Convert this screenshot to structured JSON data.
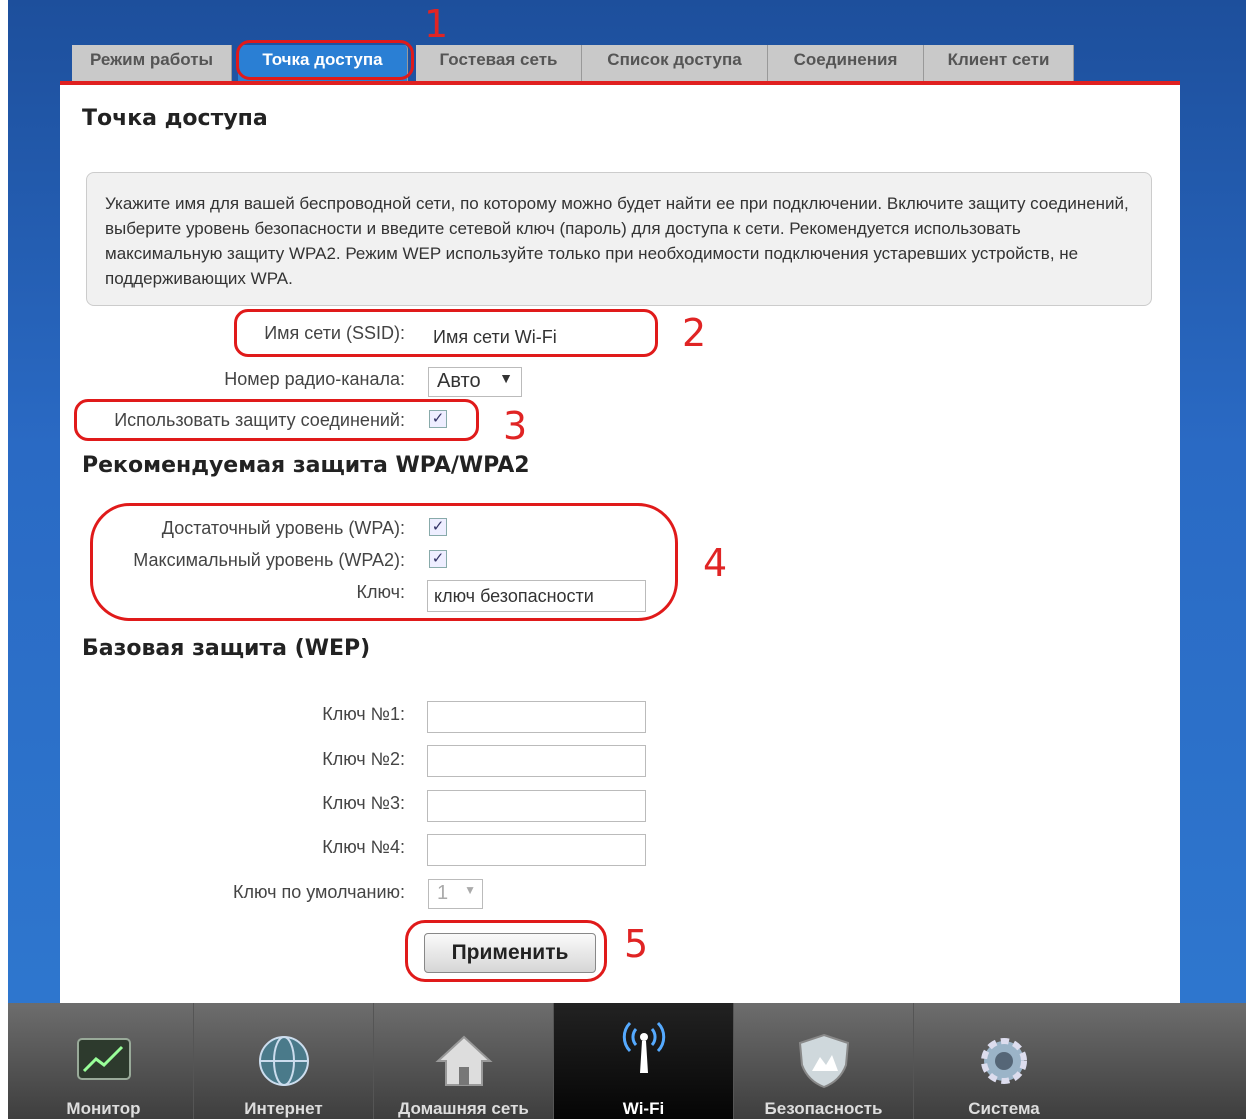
{
  "tabs": [
    "Режим работы",
    "Точка доступа",
    "Гостевая сеть",
    "Список доступа",
    "Соединения",
    "Клиент сети"
  ],
  "title": "Точка доступа",
  "note": "Укажите имя для вашей беспроводной сети, по которому можно будет найти ее при подключении. Включите защиту соединений, выберите уровень безопасности и введите сетевой ключ (пароль) для доступа к сети. Рекомендуется использовать максимальную защиту WPA2. Режим WEP используйте только при необходимости подключения устаревших устройств, не поддерживающих WPA.",
  "ssid": {
    "label": "Имя сети (SSID):",
    "value": "Имя сети Wi-Fi"
  },
  "channel": {
    "label": "Номер радио-канала:",
    "value": "Авто"
  },
  "protect": {
    "label": "Использовать защиту соединений:",
    "checked": true
  },
  "wpa_title": "Рекомендуемая защита WPA/WPA2",
  "wpa": {
    "label": "Достаточный уровень (WPA):",
    "checked": true
  },
  "wpa2": {
    "label": "Максимальный уровень (WPA2):",
    "checked": true
  },
  "key": {
    "label": "Ключ:",
    "value": "ключ безопасности"
  },
  "wep_title": "Базовая защита (WEP)",
  "wep_keys": [
    {
      "label": "Ключ №1:",
      "value": ""
    },
    {
      "label": "Ключ №2:",
      "value": ""
    },
    {
      "label": "Ключ №3:",
      "value": ""
    },
    {
      "label": "Ключ №4:",
      "value": ""
    }
  ],
  "default_key": {
    "label": "Ключ по умолчанию:",
    "value": "1"
  },
  "apply": "Применить",
  "annotations": [
    "1",
    "2",
    "3",
    "4",
    "5"
  ],
  "bottom_nav": [
    {
      "label": "Монитор",
      "icon": "monitor-icon"
    },
    {
      "label": "Интернет",
      "icon": "globe-icon"
    },
    {
      "label": "Домашняя сеть",
      "icon": "home-icon"
    },
    {
      "label": "Wi-Fi",
      "icon": "wifi-icon"
    },
    {
      "label": "Безопасность",
      "icon": "shield-icon"
    },
    {
      "label": "Система",
      "icon": "gear-icon"
    }
  ],
  "colors": {
    "accent": "#2a7fd4",
    "annotation_red": "#e02020",
    "background_blue": "#2a6ac4"
  }
}
